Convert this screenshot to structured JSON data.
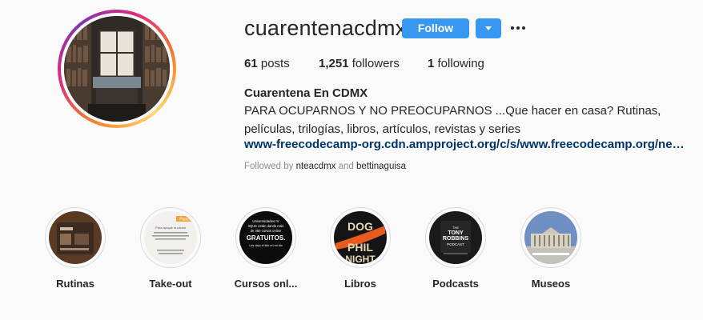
{
  "profile": {
    "username": "cuarentenacdmx",
    "follow_label": "Follow",
    "posts_count": "61",
    "posts_label": "posts",
    "followers_count": "1,251",
    "followers_label": "followers",
    "following_count": "1",
    "following_label": "following",
    "full_name": "Cuarentena En CDMX",
    "bio": "PARA OCUPARNOS Y NO PREOCUPARNOS ...Que hacer en casa? Rutinas, películas, trilogías, libros, artículos, revistas y series",
    "link": "www-freecodecamp-org.cdn.ampproject.org/c/s/www.freecodecamp.org/ne…",
    "followed_by_prefix": "Followed by",
    "followed_by_user1": "nteacdmx",
    "followed_by_and": "and",
    "followed_by_user2": "bettinaguisa"
  },
  "highlights": [
    {
      "label": "Rutinas"
    },
    {
      "label": "Take-out",
      "badge": "Paris",
      "snippet": "Para apoyar la causa"
    },
    {
      "label": "Cursos onl...",
      "snippet_lines": [
        "Universidades IV",
        "IIQUE están dando más",
        "de 450 cursos online",
        "GRATUITOS.",
        "Les dejo el link en mi bio"
      ]
    },
    {
      "label": "Libros",
      "snippet_lines": [
        "DOG",
        "PHIL",
        "NIGHT"
      ]
    },
    {
      "label": "Podcasts",
      "snippet_lines": [
        "THE",
        "TONY",
        "ROBBINS",
        "PODCAST"
      ]
    },
    {
      "label": "Museos"
    }
  ],
  "colors": {
    "accent": "#3897f0",
    "link": "#003569",
    "muted": "#8e8e8e",
    "text": "#262626"
  }
}
